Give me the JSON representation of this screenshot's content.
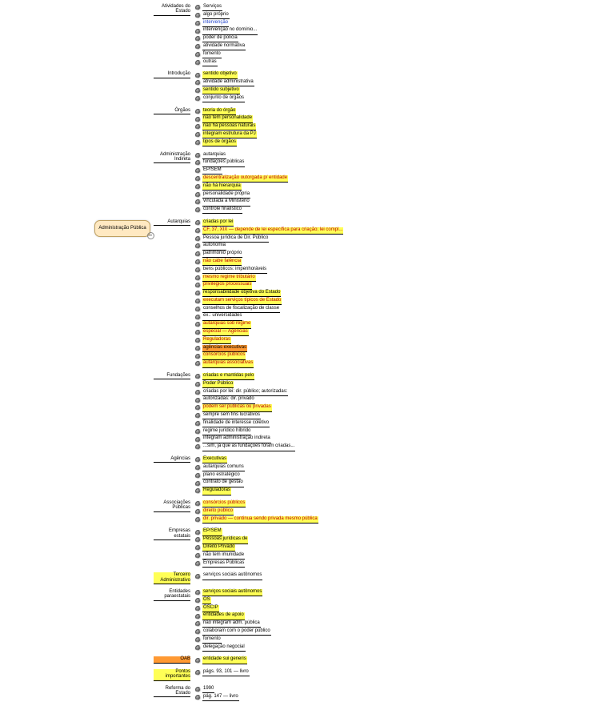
{
  "root": "Administração Pública",
  "branches": [
    {
      "label": "Atividades do Estado",
      "children": [
        {
          "t": "Serviços"
        },
        {
          "t": "algo próprio"
        },
        {
          "t": "intervenção",
          "cls": "blue"
        },
        {
          "t": "intervenção no domínio..."
        },
        {
          "t": "poder de polícia"
        },
        {
          "t": "atividade normativa"
        },
        {
          "t": "fomento"
        },
        {
          "t": "outras"
        }
      ]
    },
    {
      "label": "Introdução",
      "children": [
        {
          "t": "sentido objetivo",
          "cls": "hl"
        },
        {
          "t": "atividade administrativa"
        },
        {
          "t": "sentido subjetivo",
          "cls": "hl"
        },
        {
          "t": "conjunto de órgãos"
        }
      ]
    },
    {
      "label": "Órgãos",
      "children": [
        {
          "t": "teoria do órgão",
          "cls": "hl"
        },
        {
          "t": "não tem personalidade",
          "cls": "hl"
        },
        {
          "t": "não há pessoas naturais",
          "cls": "hl"
        },
        {
          "t": "integram estrutura da PJ",
          "cls": "hl"
        },
        {
          "t": "tipos de órgãos",
          "cls": "hl"
        }
      ]
    },
    {
      "label": "Administração Indireta",
      "children": [
        {
          "t": "autarquias"
        },
        {
          "t": "fundações públicas"
        },
        {
          "t": "EP/SEM"
        },
        {
          "t": "descentralização outorgada p/ entidade",
          "cls": "hl red"
        },
        {
          "t": "não há hierarquia",
          "cls": "hl"
        },
        {
          "t": "personalidade própria"
        },
        {
          "t": "vinculada a Ministério"
        },
        {
          "t": "controle finalístico"
        }
      ]
    },
    {
      "label": "Autarquias",
      "children": [
        {
          "t": "criadas por lei",
          "cls": "hl"
        },
        {
          "t": "CF, 37, XIX — depende de lei específica para criação; lei compl...",
          "cls": "hl red"
        },
        {
          "t": "Pessoa jurídica de Dir. Público"
        },
        {
          "t": "autonomia"
        },
        {
          "t": "patrimônio próprio"
        },
        {
          "t": "não cabe falência",
          "cls": "hl red"
        },
        {
          "t": "bens públicos: impenhoráveis"
        },
        {
          "t": "mesmo regime tributário",
          "cls": "hl red"
        },
        {
          "t": "privilégios processuais",
          "cls": "hl red"
        },
        {
          "t": "responsabilidade objetiva do Estado",
          "cls": "hl"
        },
        {
          "t": "executam serviços típicos de Estado",
          "cls": "hl red"
        },
        {
          "t": "conselhos de fiscalização de classe"
        },
        {
          "t": "ex.: universidades"
        },
        {
          "t": "autarquias sob regime",
          "cls": "hl red"
        },
        {
          "t": "especial — Agências",
          "cls": "hl red"
        },
        {
          "t": "Reguladoras",
          "cls": "hl red"
        },
        {
          "t": "agências executivas",
          "cls": "hl orange"
        },
        {
          "t": "consórcios públicos",
          "cls": "hl red"
        },
        {
          "t": "autarquias associativas",
          "cls": "hl red"
        }
      ]
    },
    {
      "label": "Fundações",
      "children": [
        {
          "t": "criadas e mantidas pelo",
          "cls": "hl"
        },
        {
          "t": "Poder Público",
          "cls": "hl"
        },
        {
          "t": "criadas por lei: dir. público; autorizadas:"
        },
        {
          "t": "autorizadas: dir. privado"
        },
        {
          "t": "podem ser públicas ou privadas",
          "cls": "hl red"
        },
        {
          "t": "sempre sem fins lucrativos"
        },
        {
          "t": "finalidade de interesse coletivo"
        },
        {
          "t": "regime jurídico híbrido"
        },
        {
          "t": "integram administração indireta"
        },
        {
          "t": "...sim, já que as fundações foram criadas..."
        }
      ]
    },
    {
      "label": "Agências",
      "children": [
        {
          "t": "Executivas",
          "cls": "hl"
        },
        {
          "t": "autarquias comuns"
        },
        {
          "t": "plano estratégico"
        },
        {
          "t": "contrato de gestão"
        },
        {
          "t": "Reguladoras",
          "cls": "hl"
        }
      ]
    },
    {
      "label": "Associações Públicas",
      "children": [
        {
          "t": "consórcios públicos",
          "cls": "hl red"
        },
        {
          "t": "direito público",
          "cls": "hl red"
        },
        {
          "t": "dir. privado — continua sendo privada mesmo pública",
          "cls": "hl red"
        }
      ]
    },
    {
      "label": "Empresas estatais",
      "children": [
        {
          "t": "EP/SEM",
          "cls": "hl"
        },
        {
          "t": "Pessoas jurídicas de",
          "cls": "hl"
        },
        {
          "t": "Direito Privado",
          "cls": "hl"
        },
        {
          "t": "não tem imunidade"
        },
        {
          "t": "Empresas Públicas"
        }
      ]
    },
    {
      "label": "Terceiro Administrativo",
      "cls": "hl",
      "children": [
        {
          "t": "serviços sociais autônomos"
        }
      ]
    },
    {
      "label": "Entidades paraestatais",
      "children": [
        {
          "t": "serviços sociais autônomos",
          "cls": "hl"
        },
        {
          "t": "OS",
          "cls": "hl"
        },
        {
          "t": "OSCIP",
          "cls": "hl"
        },
        {
          "t": "entidades de apoio",
          "cls": "hl"
        },
        {
          "t": "não integram adm. pública"
        },
        {
          "t": "colaboram com o poder público"
        },
        {
          "t": "fomento"
        },
        {
          "t": "delegação negocial"
        }
      ]
    },
    {
      "label": "OAB",
      "cls": "orange",
      "children": [
        {
          "t": "entidade sui generis",
          "cls": "hl"
        }
      ]
    },
    {
      "label": "Pontos importantes",
      "cls": "hl",
      "children": [
        {
          "t": "págs. 93, 101 — livro"
        }
      ]
    },
    {
      "label": "Reforma do Estado",
      "children": [
        {
          "t": "1990"
        },
        {
          "t": "pág. 147 — livro"
        }
      ]
    }
  ]
}
